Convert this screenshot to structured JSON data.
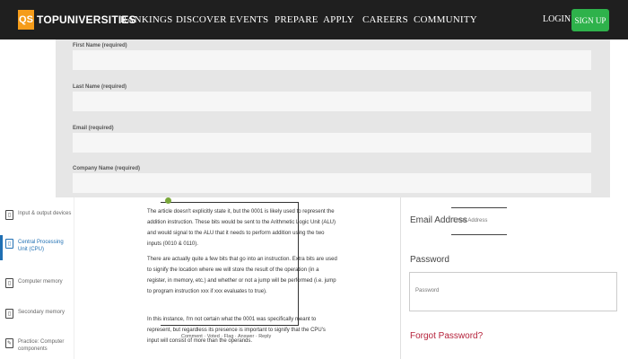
{
  "brand": {
    "logo_mark": "QS",
    "name": "TOPUNIVERSITIES",
    "accent": "#f59c1a"
  },
  "nav": [
    "RANKINGS",
    "DISCOVER",
    "EVENTS",
    "PREPARE",
    "APPLY",
    "CAREERS",
    "COMMUNITY"
  ],
  "auth": {
    "login": "LOGIN",
    "signup": "SIGN UP",
    "signup_color": "#2eb24b"
  },
  "form": {
    "fields": [
      {
        "label": "First Name (required)",
        "value": ""
      },
      {
        "label": "Last Name (required)",
        "value": ""
      },
      {
        "label": "Email (required)",
        "value": ""
      },
      {
        "label": "Company Name (required)",
        "value": ""
      }
    ]
  },
  "sidebar": {
    "items": [
      {
        "label": "Input & output devices",
        "icon": "page-icon"
      },
      {
        "label": "Central Processing Unit (CPU)",
        "icon": "page-icon",
        "active": true
      },
      {
        "label": "Computer memory",
        "icon": "page-icon"
      },
      {
        "label": "Secondary memory",
        "icon": "page-icon"
      },
      {
        "label": "Practice: Computer components",
        "icon": "pencil-icon"
      }
    ]
  },
  "article": {
    "paragraphs": [
      "The article doesn't explicitly state it, but the 0001 is likely used to represent the addition instruction. These bits would be sent to the Arithmetic Logic Unit (ALU) and would signal to the ALU that it needs to perform addition using the two inputs (0010 & 0110).",
      "There are actually quite a few bits that go into an instruction. Extra bits are used to signify the location where we will store the result of the operation (in a register, in memory, etc.) and whether or not a jump will be performed (i.e. jump to program instruction xxx if xxx evaluates to true).",
      "In this instance, I'm not certain what the 0001 was specifically meant to represent, but regardless its presence is important to signify that the CPU's input will consist of more than the operands."
    ],
    "comment_bar": "Comment   ·   Voted   ·   Flag   ·   Answer   ·   Reply"
  },
  "login_panel": {
    "email_label": "Email Address",
    "email_placeholder": "Email Address",
    "password_label": "Password",
    "password_placeholder": "Password",
    "forgot_password": "Forgot Password?",
    "forgot_color": "#b5213a"
  }
}
